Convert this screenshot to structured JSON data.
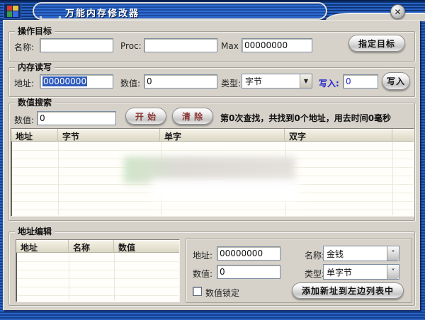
{
  "window": {
    "title": "万能内存修改器"
  },
  "icons": {
    "close": "✕",
    "dropdown_arrow": "▼",
    "chevron": "˅",
    "app_icon": "app-icon"
  },
  "target_group": {
    "title": "操作目标",
    "name_label": "名称:",
    "name_value": "",
    "proc_label": "Proc:",
    "proc_value": "",
    "max_label": "Max :",
    "max_value": "00000000",
    "specify_button": "指定目标"
  },
  "memory_group": {
    "title": "内存读写",
    "address_label": "地址:",
    "address_value": "00000000",
    "value_label": "数值:",
    "value_value": "0",
    "type_label": "类型:",
    "type_value": "字节",
    "write_label": "写入:",
    "write_value": "0",
    "write_button": "写入"
  },
  "search_group": {
    "title": "数值搜索",
    "value_label": "数值:",
    "value_value": "0",
    "start_button": "开 始",
    "clear_button": "清 除",
    "status_text": "第0次查找，共找到0个地址，用去时间0毫秒",
    "columns": [
      "地址",
      "字节",
      "单字",
      "双字"
    ],
    "rows": []
  },
  "edit_group": {
    "title": "地址编辑",
    "columns": [
      "地址",
      "名称",
      "数值"
    ],
    "rows": [],
    "address_label": "地址:",
    "address_value": "00000000",
    "name_label": "名称:",
    "name_value": "金钱",
    "value_label": "数值:",
    "value_value": "0",
    "type_label": "类型:",
    "type_value": "单字节",
    "lock_checkbox_label": "数值锁定",
    "lock_checked": false,
    "add_button": "添加新址到左边列表中"
  },
  "colors": {
    "title_stripe_blue": "#2a63c4",
    "body_bg": "#d6d2c9",
    "selection_blue": "#2e5bbe",
    "button_text_red": "#8a3434",
    "write_label_blue": "#2626cc",
    "list_header_bg": "#e8e4d4"
  }
}
